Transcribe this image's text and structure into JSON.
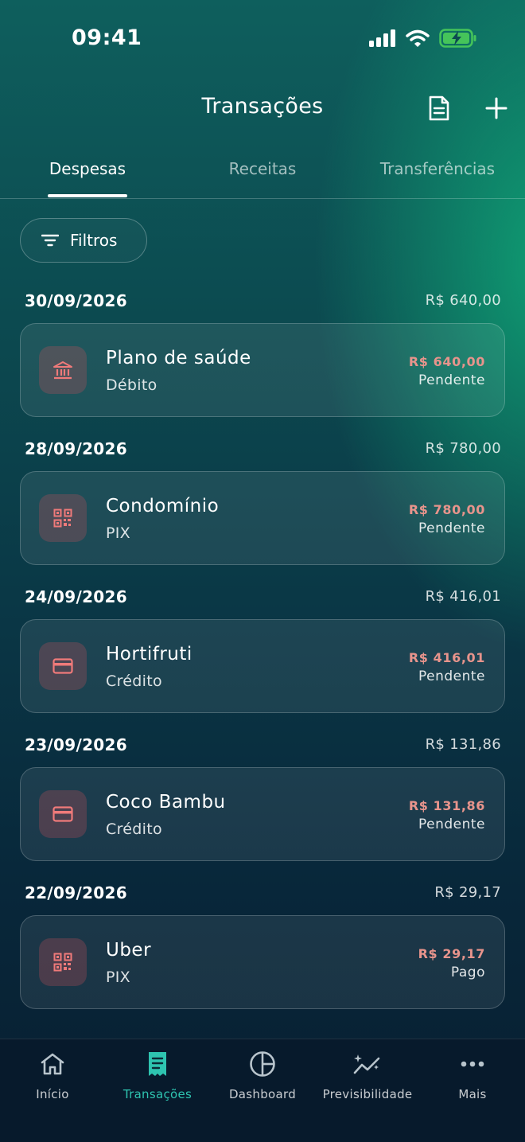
{
  "status_bar": {
    "time": "09:41"
  },
  "header": {
    "title": "Transações",
    "icons": [
      "document-icon",
      "plus-icon"
    ]
  },
  "tabs": [
    {
      "label": "Despesas",
      "active": true
    },
    {
      "label": "Receitas",
      "active": false
    },
    {
      "label": "Transferências",
      "active": false
    }
  ],
  "filter": {
    "label": "Filtros",
    "icon": "filter-icon"
  },
  "groups": [
    {
      "date": "30/09/2026",
      "total": "R$ 640,00",
      "tx": {
        "name": "Plano de saúde",
        "method": "Débito",
        "amount": "R$ 640,00",
        "status": "Pendente",
        "icon": "bank-icon"
      }
    },
    {
      "date": "28/09/2026",
      "total": "R$ 780,00",
      "tx": {
        "name": "Condomínio",
        "method": "PIX",
        "amount": "R$ 780,00",
        "status": "Pendente",
        "icon": "qr-code-icon"
      }
    },
    {
      "date": "24/09/2026",
      "total": "R$ 416,01",
      "tx": {
        "name": "Hortifruti",
        "method": "Crédito",
        "amount": "R$ 416,01",
        "status": "Pendente",
        "icon": "credit-card-icon"
      }
    },
    {
      "date": "23/09/2026",
      "total": "R$ 131,86",
      "tx": {
        "name": "Coco Bambu",
        "method": "Crédito",
        "amount": "R$ 131,86",
        "status": "Pendente",
        "icon": "credit-card-icon"
      }
    },
    {
      "date": "22/09/2026",
      "total": "R$ 29,17",
      "tx": {
        "name": "Uber",
        "method": "PIX",
        "amount": "R$ 29,17",
        "status": "Pago",
        "icon": "qr-code-icon"
      }
    }
  ],
  "bottom_nav": [
    {
      "label": "Início",
      "icon": "home-icon",
      "active": false
    },
    {
      "label": "Transações",
      "icon": "receipt-icon",
      "active": true
    },
    {
      "label": "Dashboard",
      "icon": "pie-chart-icon",
      "active": false
    },
    {
      "label": "Previsibilidade",
      "icon": "trend-sparkle-icon",
      "active": false
    },
    {
      "label": "Mais",
      "icon": "more-dots-icon",
      "active": false
    }
  ],
  "colors": {
    "accent": "#2ec4b0",
    "expense": "#e8948c",
    "icon_bg": "#5a3a46"
  }
}
